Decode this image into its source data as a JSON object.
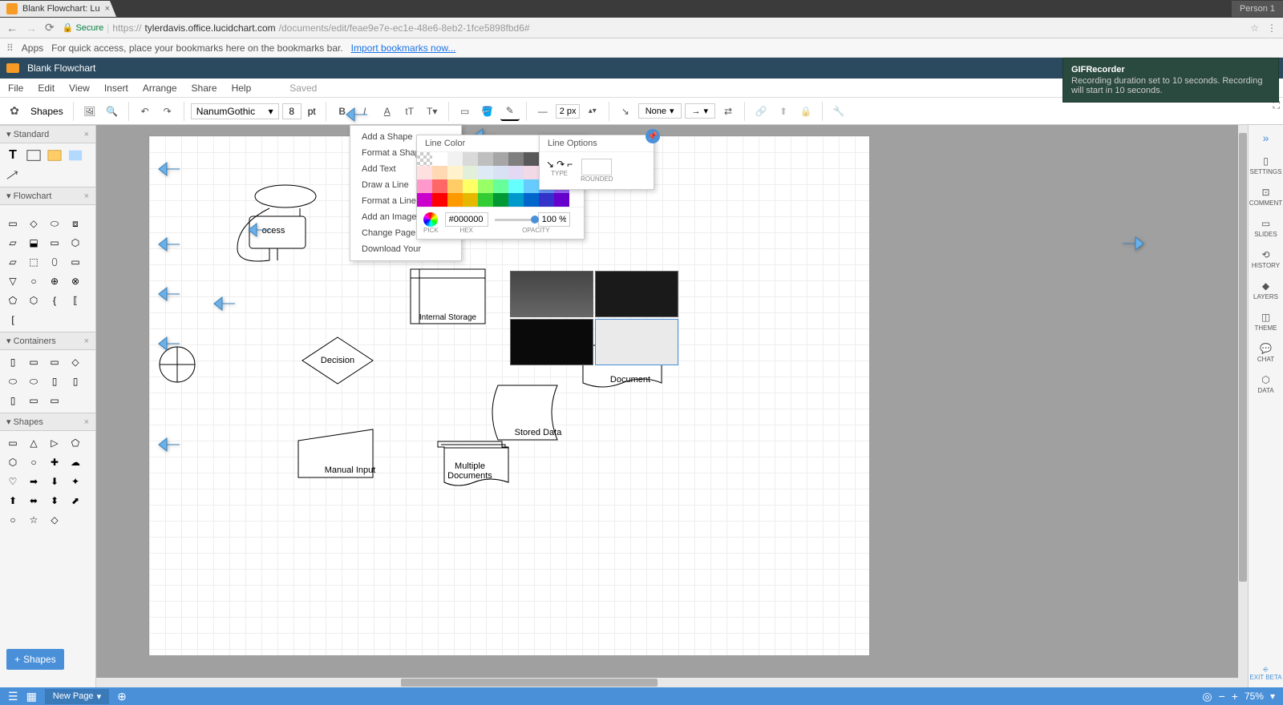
{
  "browser": {
    "tab_title": "Blank Flowchart: Lu",
    "persona": "Person 1",
    "secure_label": "Secure",
    "url_host": "tylerdavis.office.lucidchart.com",
    "url_path": "/documents/edit/feae9e7e-ec1e-48e6-8eb2-1fce5898fbd6#",
    "url_prefix": "https://",
    "bookmark_apps": "Apps",
    "bookmark_hint": "For quick access, place your bookmarks here on the bookmarks bar.",
    "import_link": "Import bookmarks now..."
  },
  "lucid": {
    "doc_title": "Blank Flowchart",
    "menu": [
      "File",
      "Edit",
      "View",
      "Insert",
      "Arrange",
      "Share",
      "Help"
    ],
    "saved_label": "Saved"
  },
  "toolbar": {
    "shapes_label": "Shapes",
    "font_name": "NanumGothic",
    "font_size": "8",
    "font_unit": "pt",
    "line_width": "2 px",
    "line_style_none": "None"
  },
  "left_panels": {
    "standard": "Standard",
    "flowchart": "Flowchart",
    "containers": "Containers",
    "shapes": "Shapes",
    "add_shapes": "Shapes"
  },
  "context_menu": {
    "items": [
      "Add a Shape",
      "Format a Shape",
      "Add Text",
      "Draw a Line",
      "Format a Line",
      "Add an Image",
      "Change Page Se",
      "Download Your"
    ]
  },
  "line_color_panel": {
    "title": "Line Color",
    "pick_label": "PICK",
    "hex_label": "HEX",
    "hex_value": "#000000",
    "opacity_label": "OPACITY",
    "opacity_value": "100 %"
  },
  "line_options_panel": {
    "title": "Line Options",
    "type_label": "TYPE",
    "rounded_label": "ROUNDED"
  },
  "canvas_shapes": {
    "process": "ocess",
    "internal_storage": "Internal Storage",
    "decision": "Decision",
    "document": "Document",
    "stored_data": "Stored Data",
    "multiple_docs_1": "Multiple",
    "multiple_docs_2": "Documents",
    "manual_input": "Manual Input"
  },
  "right_sidebar": {
    "settings": "SETTINGS",
    "comment": "COMMENT",
    "slides": "SLIDES",
    "history": "HISTORY",
    "layers": "LAYERS",
    "theme": "THEME",
    "chat": "CHAT",
    "data": "DATA",
    "exit_beta": "EXIT BETA"
  },
  "bottom": {
    "page_tab": "New Page",
    "zoom": "75%"
  },
  "gif_notify": {
    "title": "GIFRecorder",
    "body": "Recording duration set to 10 seconds. Recording will start in 10 seconds."
  },
  "colors": {
    "palette": [
      "transparent",
      "#ffffff",
      "#f2f2f2",
      "#d9d9d9",
      "#bfbfbf",
      "#a6a6a6",
      "#7f7f7f",
      "#595959",
      "#404040",
      "#000000",
      "#ffe0e0",
      "#ffd9b3",
      "#fff2cc",
      "#e2f0d9",
      "#deebf7",
      "#d9e2f3",
      "#e4d9f2",
      "#f2d9e6",
      "#cce5ff",
      "#b3d9ff",
      "#ff99cc",
      "#ff6666",
      "#ffcc66",
      "#ffff66",
      "#99ff66",
      "#66ff99",
      "#66ffff",
      "#66ccff",
      "#6699ff",
      "#9966ff",
      "#cc00cc",
      "#ff0000",
      "#ff9900",
      "#e6b800",
      "#33cc33",
      "#009933",
      "#0099cc",
      "#0066cc",
      "#3333cc",
      "#6600cc"
    ]
  }
}
